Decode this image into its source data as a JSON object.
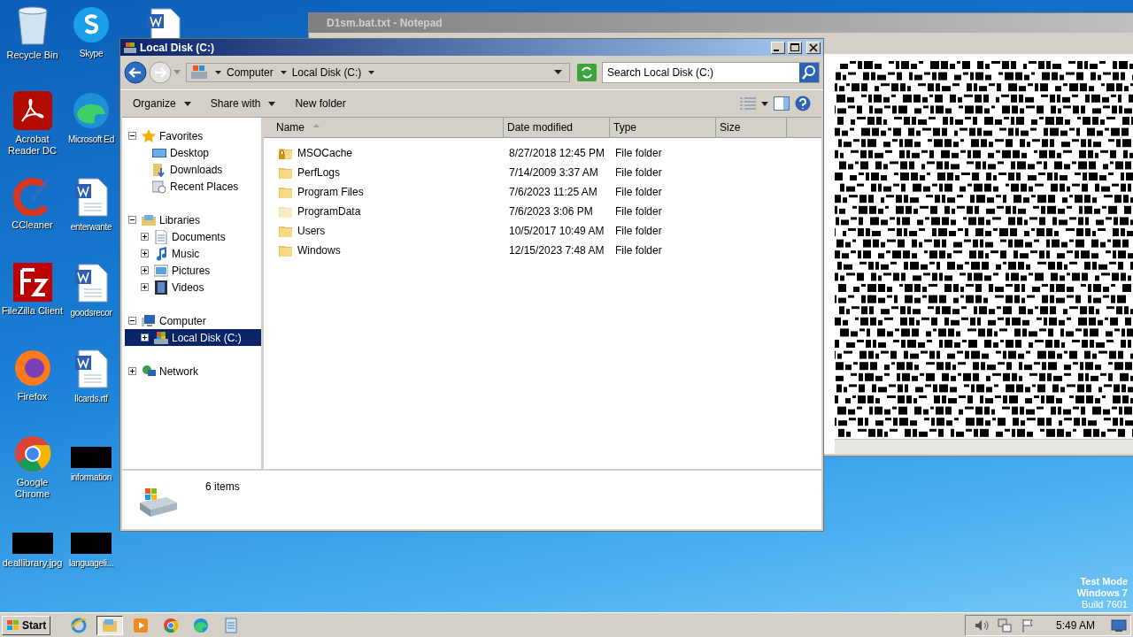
{
  "desktop_icons": [
    {
      "kind": "recycle",
      "label": "Recycle Bin"
    },
    {
      "kind": "skype",
      "label": "Skype"
    },
    {
      "kind": "acrobat",
      "label": "Acrobat Reader DC"
    },
    {
      "kind": "edge",
      "label": "Microsoft Ed"
    },
    {
      "kind": "ccleaner",
      "label": "CCleaner"
    },
    {
      "kind": "word",
      "label": "enterwante"
    },
    {
      "kind": "filezilla",
      "label": "FileZilla Client"
    },
    {
      "kind": "word",
      "label": "goodsrecor"
    },
    {
      "kind": "firefox",
      "label": "Firefox"
    },
    {
      "kind": "word",
      "label": "llcards.rtf"
    },
    {
      "kind": "chrome",
      "label": "Google Chrome"
    },
    {
      "kind": "redacted",
      "label": "information"
    },
    {
      "kind": "redacted",
      "label": "deallibrary.jpg"
    },
    {
      "kind": "redacted",
      "label": "languageli..."
    }
  ],
  "hidden_desktop_icon": {
    "kind": "word"
  },
  "notepad": {
    "title": "D1sm.bat.txt - Notepad"
  },
  "explorer": {
    "title": "Local Disk (C:)",
    "breadcrumb": [
      "Computer",
      "Local Disk (C:)"
    ],
    "search": {
      "placeholder": "Search Local Disk (C:)"
    },
    "toolbar": [
      {
        "label": "Organize",
        "dropdown": true
      },
      {
        "label": "Share with",
        "dropdown": true
      },
      {
        "label": "New folder",
        "dropdown": false
      }
    ],
    "tree": [
      {
        "label": "Favorites",
        "kind": "star",
        "expanded": true,
        "selected": false,
        "children": [
          {
            "label": "Desktop",
            "kind": "desktop",
            "selected": false
          },
          {
            "label": "Downloads",
            "kind": "downloads",
            "selected": false
          },
          {
            "label": "Recent Places",
            "kind": "recent",
            "selected": false
          }
        ]
      },
      {
        "label": "Libraries",
        "kind": "library",
        "expanded": true,
        "selected": false,
        "children": [
          {
            "label": "Documents",
            "kind": "documents",
            "expanded": false,
            "selected": false
          },
          {
            "label": "Music",
            "kind": "music",
            "expanded": false,
            "selected": false
          },
          {
            "label": "Pictures",
            "kind": "pictures",
            "expanded": false,
            "selected": false
          },
          {
            "label": "Videos",
            "kind": "videos",
            "expanded": false,
            "selected": false
          }
        ]
      },
      {
        "label": "Computer",
        "kind": "computer",
        "expanded": true,
        "selected": false,
        "children": [
          {
            "label": "Local Disk (C:)",
            "kind": "disk",
            "expanded": false,
            "selected": true
          }
        ]
      },
      {
        "label": "Network",
        "kind": "network",
        "expanded": false,
        "selected": false
      }
    ],
    "columns": [
      {
        "label": "Name",
        "sorted": true
      },
      {
        "label": "Date modified",
        "sorted": false
      },
      {
        "label": "Type",
        "sorted": false
      },
      {
        "label": "Size",
        "sorted": false
      }
    ],
    "files": [
      {
        "name": "MSOCache",
        "date": "8/27/2018 12:45 PM",
        "type": "File folder",
        "kind": "locked"
      },
      {
        "name": "PerfLogs",
        "date": "7/14/2009 3:37 AM",
        "type": "File folder",
        "kind": "folder"
      },
      {
        "name": "Program Files",
        "date": "7/6/2023 11:25 AM",
        "type": "File folder",
        "kind": "folder"
      },
      {
        "name": "ProgramData",
        "date": "7/6/2023 3:06 PM",
        "type": "File folder",
        "kind": "hidden"
      },
      {
        "name": "Users",
        "date": "10/5/2017 10:49 AM",
        "type": "File folder",
        "kind": "folder"
      },
      {
        "name": "Windows",
        "date": "12/15/2023 7:48 AM",
        "type": "File folder",
        "kind": "folder"
      }
    ],
    "status": "6 items"
  },
  "taskbar": {
    "start": "Start",
    "apps": [
      {
        "kind": "ie",
        "selected": false
      },
      {
        "kind": "explorer",
        "selected": true
      },
      {
        "kind": "media",
        "selected": false
      },
      {
        "kind": "chrome",
        "selected": false
      },
      {
        "kind": "edge",
        "selected": false
      },
      {
        "kind": "notepad",
        "selected": false
      }
    ],
    "time": "5:49 AM"
  },
  "os_notice": [
    "Test Mode",
    "Windows 7",
    "Build 7601"
  ]
}
